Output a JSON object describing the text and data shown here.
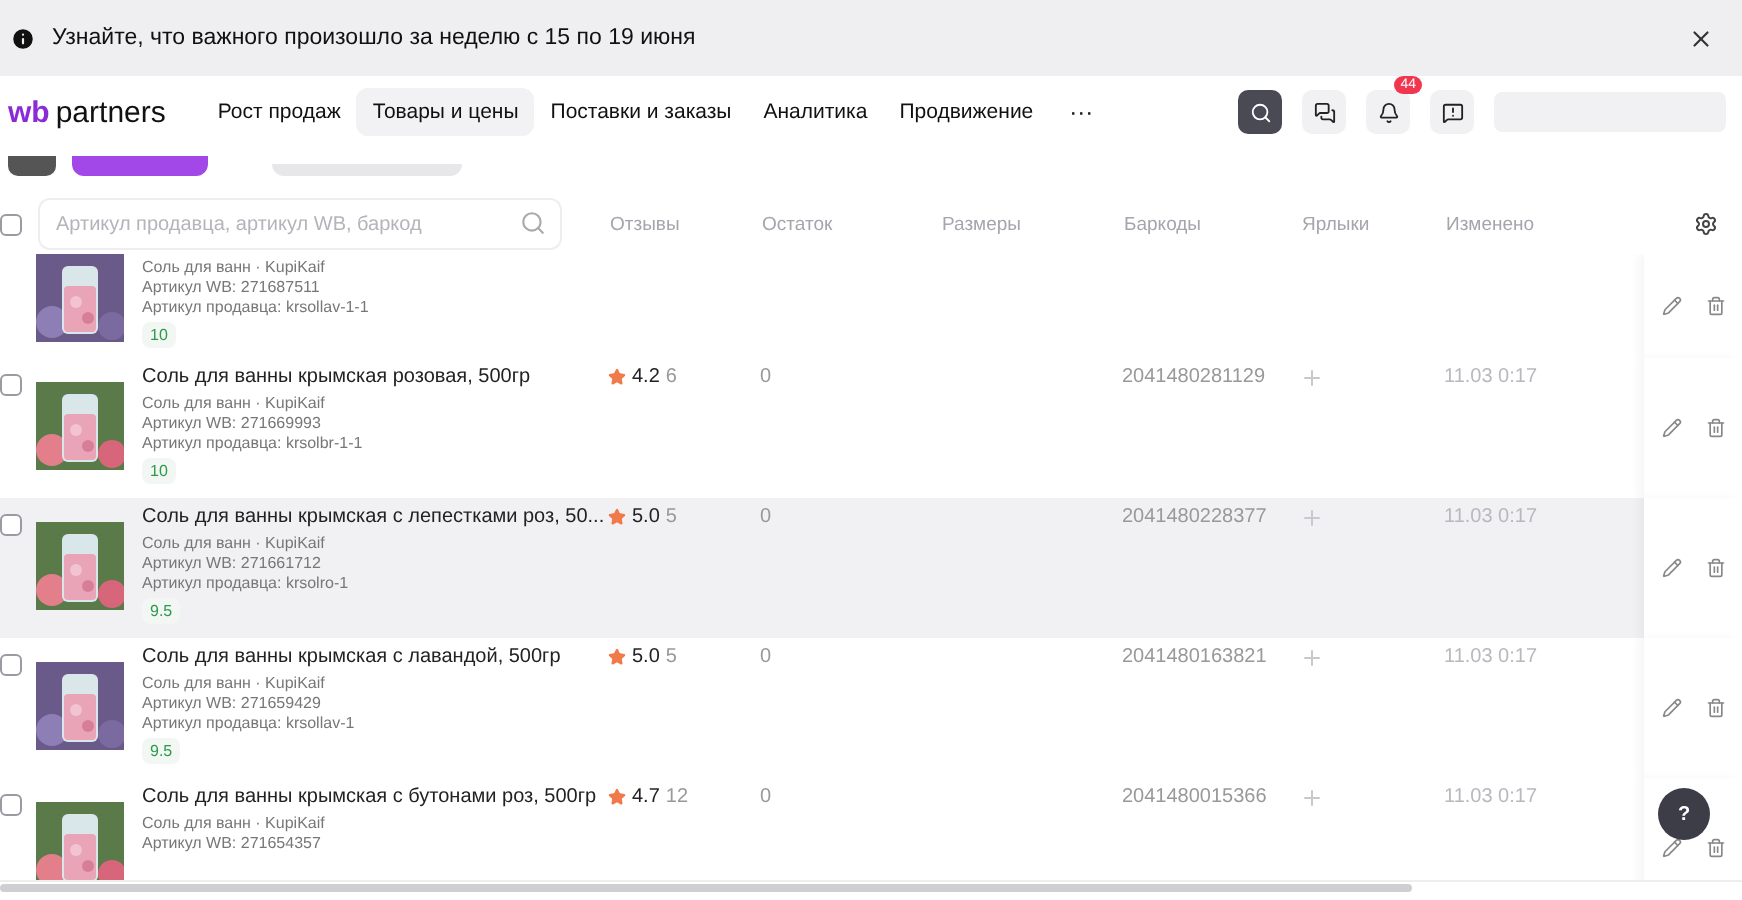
{
  "banner": {
    "text": "Узнайте, что важного произошло за неделю с 15 по 19 июня"
  },
  "nav": {
    "logo_a": "wb",
    "logo_b": "partners",
    "items": [
      {
        "label": "Рост продаж",
        "selected": false
      },
      {
        "label": "Товары и цены",
        "selected": true
      },
      {
        "label": "Поставки и заказы",
        "selected": false
      },
      {
        "label": "Аналитика",
        "selected": false
      },
      {
        "label": "Продвижение",
        "selected": false
      }
    ],
    "more": "···",
    "notifications": "44"
  },
  "table": {
    "select_all": {
      "checked": false
    },
    "search_placeholder": "Артикул продавца, артикул WB, баркод",
    "columns": [
      "Отзывы",
      "Остаток",
      "Размеры",
      "Баркоды",
      "Ярлыки",
      "Изменено"
    ],
    "rows": [
      {
        "kind": "partial",
        "brand": "Соль для ванн · KupiKaif",
        "wb": "Артикул WB: 271687511",
        "seller": "Артикул продавца: krsollav-1-1",
        "badge": "10",
        "highlighted": false
      },
      {
        "kind": "full",
        "checked": false,
        "title": "Соль для ванны крымская розовая, 500гр",
        "brand": "Соль для ванн · KupiKaif",
        "wb": "Артикул WB: 271669993",
        "seller": "Артикул продавца: krsolbr-1-1",
        "badge": "10",
        "rating": "4.2",
        "reviews": "6",
        "stock": "0",
        "barcode": "2041480281129",
        "date": "11.03 0:17",
        "highlighted": false
      },
      {
        "kind": "full",
        "checked": false,
        "title": "Соль для ванны крымская с лепестками роз, 50...",
        "brand": "Соль для ванн · KupiKaif",
        "wb": "Артикул WB: 271661712",
        "seller": "Артикул продавца: krsolro-1",
        "badge": "9.5",
        "rating": "5.0",
        "reviews": "5",
        "stock": "0",
        "barcode": "2041480228377",
        "date": "11.03 0:17",
        "highlighted": true
      },
      {
        "kind": "full",
        "checked": false,
        "title": "Соль для ванны крымская с лавандой, 500гр",
        "brand": "Соль для ванн · KupiKaif",
        "wb": "Артикул WB: 271659429",
        "seller": "Артикул продавца: krsollav-1",
        "badge": "9.5",
        "rating": "5.0",
        "reviews": "5",
        "stock": "0",
        "barcode": "2041480163821",
        "date": "11.03 0:17",
        "highlighted": false
      },
      {
        "kind": "full",
        "checked": false,
        "title": "Соль для ванны крымская с бутонами роз, 500гр",
        "brand": "Соль для ванн · KupiKaif",
        "wb": "Артикул WB: 271654357",
        "rating": "4.7",
        "reviews": "12",
        "stock": "0",
        "barcode": "2041480015366",
        "date": "11.03 0:17",
        "highlighted": false
      }
    ]
  },
  "help": "?"
}
